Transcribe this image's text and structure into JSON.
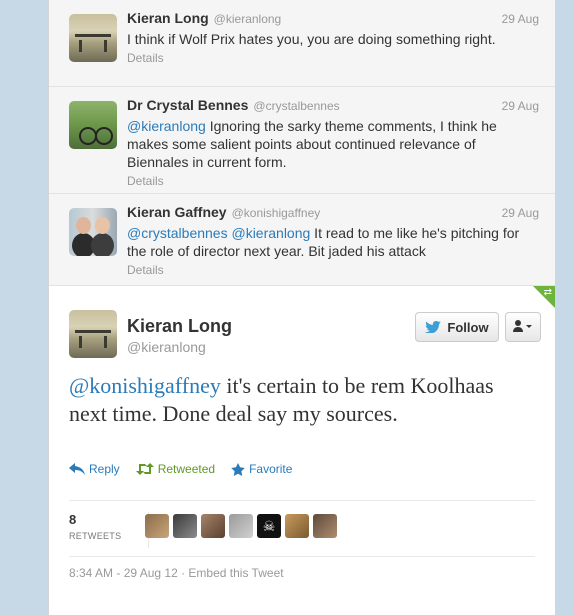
{
  "replies": [
    {
      "name": "Kieran Long",
      "handle": "@kieranlong",
      "date": "29 Aug",
      "text": "I think if Wolf Prix hates you, you are doing something right.",
      "mention": "",
      "details": "Details",
      "avatar": "bench-photo"
    },
    {
      "name": "Dr Crystal Bennes",
      "handle": "@crystalbennes",
      "date": "29 Aug",
      "mention": "@kieranlong",
      "text": " Ignoring the sarky theme comments, I think he makes some salient points about continued relevance of Biennales in current form.",
      "details": "Details",
      "avatar": "bike-photo"
    },
    {
      "name": "Kieran Gaffney",
      "handle": "@konishigaffney",
      "date": "29 Aug",
      "mention": "@crystalbennes @kieranlong",
      "text": " It read to me like he's pitching for the role of director next year. Bit jaded his attack",
      "details": "Details",
      "avatar": "couple-photo"
    }
  ],
  "main": {
    "name": "Kieran Long",
    "handle": "@kieranlong",
    "follow_label": "Follow",
    "mention": "@konishigaffney",
    "text": " it's certain to be rem Koolhaas next time. Done deal say my sources.",
    "actions": {
      "reply": "Reply",
      "retweeted": "Retweeted",
      "favorite": "Favorite"
    },
    "retweet_count": "8",
    "retweet_label": "RETWEETS",
    "meta": "8:34 AM - 29 Aug 12 · Embed this Tweet",
    "retweeter_colors": [
      "#8a6d4a",
      "#3a3a3a",
      "#a5846a",
      "#9b9b9b",
      "#111111",
      "#c79a5e",
      "#5d4a3c"
    ]
  },
  "colors": {
    "link": "#2b7bb9",
    "retweeted": "#609928",
    "dog_ear": "#6fb33f"
  },
  "icons": {
    "follow": "twitter-bird-icon",
    "user_menu": "user-dropdown-icon",
    "reply": "reply-arrow-icon",
    "retweet": "retweet-icon",
    "favorite": "star-icon"
  }
}
